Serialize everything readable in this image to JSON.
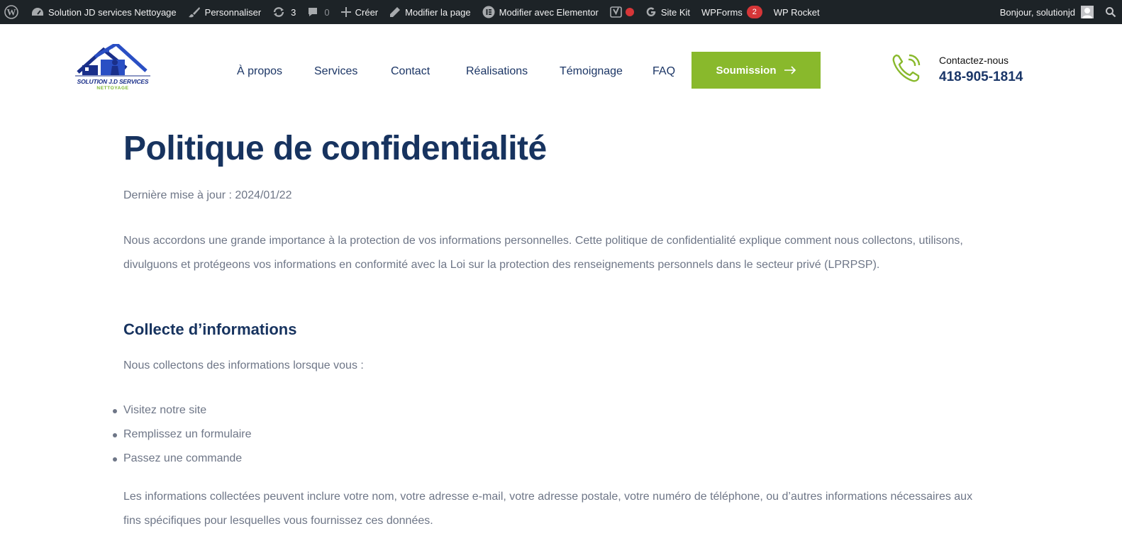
{
  "adminbar": {
    "site_name": "Solution JD services Nettoyage",
    "customize": "Personnaliser",
    "updates_count": "3",
    "comments_count": "0",
    "new": "Créer",
    "edit_page": "Modifier la page",
    "edit_elementor": "Modifier avec Elementor",
    "site_kit": "Site Kit",
    "wpforms": "WPForms",
    "wpforms_badge": "2",
    "wp_rocket": "WP Rocket",
    "greeting": "Bonjour, solutionjd"
  },
  "header": {
    "logo_line1": "SOLUTION J.D SERVICES",
    "logo_line2": "NETTOYAGE",
    "nav": [
      "À propos",
      "Services",
      "Contact",
      "Réalisations",
      "Témoignage",
      "FAQ"
    ],
    "cta_label": "Soumission",
    "contact_label": "Contactez-nous",
    "contact_phone": "418-905-1814"
  },
  "content": {
    "title": "Politique de confidentialité",
    "updated": "Dernière mise à jour : 2024/01/22",
    "paragraph1": "Nous accordons une grande importance à la protection de vos informations personnelles. Cette politique de confidentialité explique comment nous collectons, utilisons, divulguons et protégeons vos informations en conformité avec la Loi sur la protection des renseignements personnels dans le secteur privé (LPRPSP).",
    "heading_collect": "Collecte d’informations",
    "intro_collect": "Nous collectons des informations lorsque vous :",
    "list_collect": [
      "Visitez notre site",
      "Remplissez un formulaire",
      "Passez une commande"
    ],
    "paragraph2": "Les informations collectées peuvent inclure votre nom, votre adresse e-mail, votre adresse postale, votre numéro de téléphone, ou d’autres informations nécessaires aux fins spécifiques pour lesquelles vous fournissez ces données."
  },
  "colors": {
    "adminbar_bg": "#1d2327",
    "brand_navy": "#17335f",
    "brand_green": "#89b92c",
    "body_text": "#6e7687",
    "badge_red": "#d63638"
  },
  "icons": [
    "wordpress-icon",
    "dashboard-icon",
    "brush-icon",
    "updates-icon",
    "comment-icon",
    "plus-icon",
    "pencil-icon",
    "elementor-icon",
    "yoast-icon",
    "google-icon",
    "avatar-icon",
    "search-icon",
    "arrow-right-icon",
    "phone-icon"
  ]
}
